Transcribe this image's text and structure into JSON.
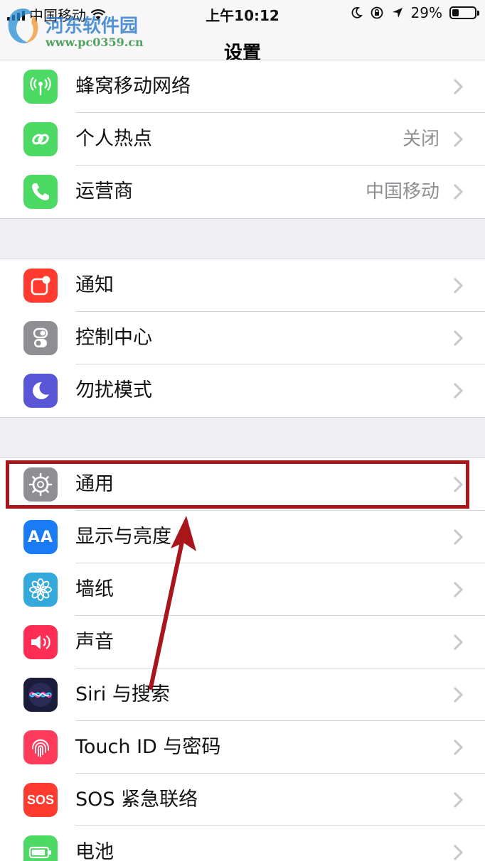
{
  "status_bar": {
    "carrier": "中国移动",
    "time": "上午10:12",
    "battery_percent": "29%",
    "battery_level": 0.29
  },
  "watermark": {
    "title": "河东软件园",
    "url": "www.pc0359.cn"
  },
  "nav": {
    "title": "设置"
  },
  "groups": [
    {
      "items": [
        {
          "label": "蜂窝移动网络",
          "value": "",
          "icon": "cellular-antenna-icon",
          "color": "#4cd964"
        },
        {
          "label": "个人热点",
          "value": "关闭",
          "icon": "hotspot-chain-icon",
          "color": "#4cd964"
        },
        {
          "label": "运营商",
          "value": "中国移动",
          "icon": "phone-icon",
          "color": "#4cd964"
        }
      ]
    },
    {
      "items": [
        {
          "label": "通知",
          "value": "",
          "icon": "notification-icon",
          "color": "#ff3b30"
        },
        {
          "label": "控制中心",
          "value": "",
          "icon": "control-center-toggle-icon",
          "color": "#8e8e93"
        },
        {
          "label": "勿扰模式",
          "value": "",
          "icon": "moon-icon",
          "color": "#5856d6"
        }
      ]
    },
    {
      "items": [
        {
          "label": "通用",
          "value": "",
          "icon": "gear-icon",
          "color": "#8e8e93"
        },
        {
          "label": "显示与亮度",
          "value": "",
          "icon": "text-size-aa-icon",
          "color": "#1a7cf5",
          "icon_text": "AA"
        },
        {
          "label": "墙纸",
          "value": "",
          "icon": "flower-icon",
          "color": "#34aadc"
        },
        {
          "label": "声音",
          "value": "",
          "icon": "speaker-icon",
          "color": "#ff2d55"
        },
        {
          "label": "Siri 与搜索",
          "value": "",
          "icon": "siri-icon",
          "color": "#1b1b3a"
        },
        {
          "label": "Touch ID 与密码",
          "value": "",
          "icon": "fingerprint-icon",
          "color": "#ff3b5c"
        },
        {
          "label": "SOS 紧急联络",
          "value": "",
          "icon": "sos-icon",
          "color": "#ff3b30",
          "icon_text": "SOS"
        },
        {
          "label": "电池",
          "value": "",
          "icon": "battery-icon",
          "color": "#4cd964"
        }
      ]
    }
  ],
  "colors": {
    "annotation": "#a8161c",
    "background": "#efeff4"
  }
}
